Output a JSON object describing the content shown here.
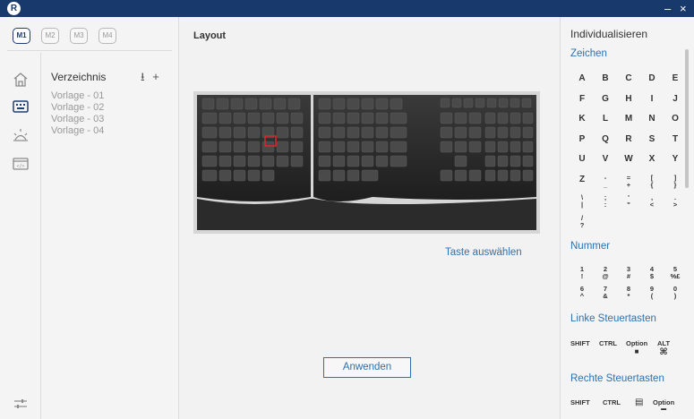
{
  "window": {
    "logo": "R",
    "minimize": "–",
    "close": "×"
  },
  "modes": [
    {
      "label": "M1",
      "active": true
    },
    {
      "label": "M2",
      "active": false
    },
    {
      "label": "M3",
      "active": false
    },
    {
      "label": "M4",
      "active": false
    }
  ],
  "sidebar": {
    "icons": [
      "home-icon",
      "keyboard-icon",
      "lighting-icon",
      "macro-icon",
      "settings-sliders-icon"
    ],
    "directory_title": "Verzeichnis",
    "import_label": "⭳",
    "add_label": "+",
    "presets": [
      "Vorlage - 01",
      "Vorlage - 02",
      "Vorlage - 03",
      "Vorlage - 04"
    ]
  },
  "main": {
    "title": "Layout",
    "select_key_label": "Taste auswählen",
    "apply_label": "Anwenden"
  },
  "customize": {
    "title": "Individualisieren",
    "characters_title": "Zeichen",
    "letters": [
      "A",
      "B",
      "C",
      "D",
      "E",
      "F",
      "G",
      "H",
      "I",
      "J",
      "K",
      "L",
      "M",
      "N",
      "O",
      "P",
      "Q",
      "R",
      "S",
      "T",
      "U",
      "V",
      "W",
      "X",
      "Y",
      "Z"
    ],
    "symbols": [
      [
        "-",
        "_"
      ],
      [
        "=",
        "+"
      ],
      [
        "[",
        "{"
      ],
      [
        "]",
        "}"
      ],
      [
        "\\",
        "|"
      ],
      [
        ";",
        ":"
      ],
      [
        "'",
        "\""
      ],
      [
        ",",
        "<"
      ],
      [
        ".",
        ">"
      ],
      [
        "/",
        "?"
      ]
    ],
    "number_title": "Nummer",
    "numbers": [
      [
        "1",
        "!"
      ],
      [
        "2",
        "@"
      ],
      [
        "3",
        "#"
      ],
      [
        "4",
        "$"
      ],
      [
        "5",
        "%£"
      ],
      [
        "6",
        "^"
      ],
      [
        "7",
        "&"
      ],
      [
        "8",
        "*"
      ],
      [
        "9",
        "("
      ],
      [
        "0",
        ")"
      ]
    ],
    "left_mod_title": "Linke Steuertasten",
    "left_mods": [
      "SHIFT",
      "CTRL",
      "Option",
      "ALT"
    ],
    "right_mod_title": "Rechte Steuertasten",
    "right_mods": [
      "SHIFT",
      "CTRL",
      "Option"
    ]
  },
  "colors": {
    "titlebar": "#17396b",
    "accent": "#2b71b3",
    "selected_key": "#d9262c"
  }
}
